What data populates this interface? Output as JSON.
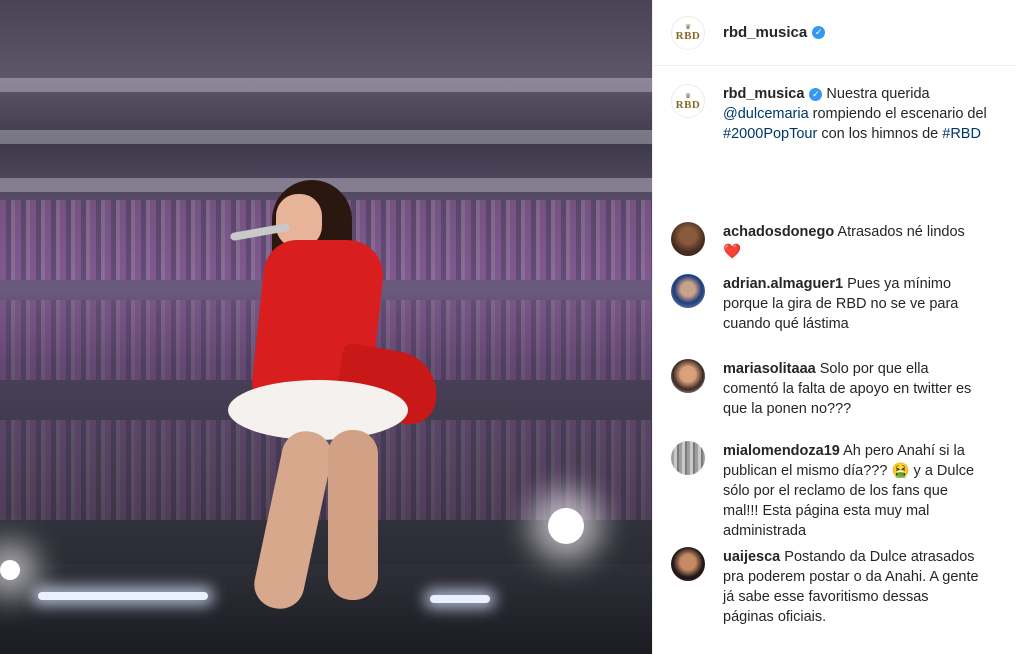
{
  "post": {
    "author": "rbd_musica",
    "avatar_text": "RBD",
    "verified": true,
    "caption": {
      "before_mention": " Nuestra querida ",
      "mention": "@dulcemaria",
      "mid1": " rompiendo el escenario del ",
      "hashtag1": "#2000PopTour",
      "mid2": " con los himnos de ",
      "hashtag2": "#RBD"
    }
  },
  "comments": [
    {
      "user": "achadosdonego",
      "text": " Atrasados né lindos ",
      "emoji": "❤️"
    },
    {
      "user": "adrian.almaguer1",
      "text": " Pues ya mínimo porque la gira de RBD no se ve para cuando qué lástima"
    },
    {
      "user": "mariasolitaaa",
      "text": " Solo por que ella comentó la falta de apoyo en twitter es que la ponen no???"
    },
    {
      "user": "mialomendoza19",
      "text_before": " Ah pero Anahí si la publican el mismo día??? ",
      "emoji": "🤮",
      "text_after": " y a Dulce sólo por el reclamo de los fans que mal!!! Esta página esta muy mal administrada"
    },
    {
      "user": "uaijesca",
      "text": " Postando da Dulce atrasados pra poderem postar o da Anahi. A gente já sabe esse favoritismo dessas páginas oficiais."
    }
  ],
  "icons": {
    "verified": "verified-badge-icon"
  },
  "colors": {
    "link": "#00376b",
    "verified": "#3897f0",
    "text": "#262626"
  }
}
